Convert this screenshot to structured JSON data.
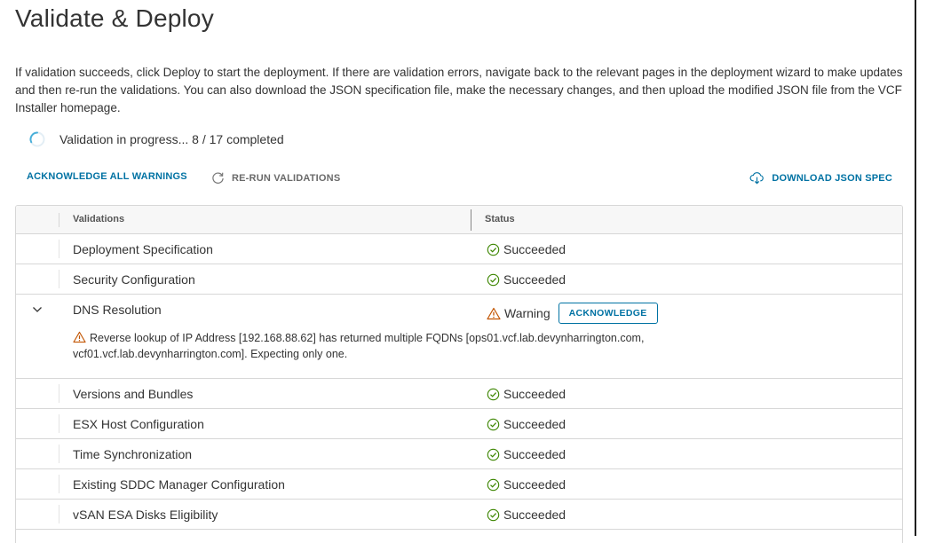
{
  "page": {
    "title": "Validate & Deploy",
    "description": "If validation succeeds, click Deploy to start the deployment. If there are validation errors, navigate back to the relevant pages in the deployment wizard to make updates and then re-run the validations. You can also download the JSON specification file, make the necessary changes, and then upload the modified JSON file from the VCF Installer homepage.",
    "progress_text": "Validation in progress... 8 / 17 completed"
  },
  "toolbar": {
    "acknowledge_all": "ACKNOWLEDGE ALL WARNINGS",
    "rerun": "RE-RUN VALIDATIONS",
    "download": "DOWNLOAD JSON SPEC"
  },
  "grid": {
    "col_validations": "Validations",
    "col_status": "Status",
    "rows": [
      {
        "name": "Deployment Specification",
        "status": "Succeeded"
      },
      {
        "name": "Security Configuration",
        "status": "Succeeded"
      },
      {
        "name": "DNS Resolution",
        "status": "Warning",
        "action": "ACKNOWLEDGE",
        "detail": "Reverse lookup of IP Address [192.168.88.62] has returned multiple FQDNs [ops01.vcf.lab.devynharrington.com, vcf01.vcf.lab.devynharrington.com]. Expecting only one."
      },
      {
        "name": "Versions and Bundles",
        "status": "Succeeded"
      },
      {
        "name": "ESX Host Configuration",
        "status": "Succeeded"
      },
      {
        "name": "Time Synchronization",
        "status": "Succeeded"
      },
      {
        "name": "Existing SDDC Manager Configuration",
        "status": "Succeeded"
      },
      {
        "name": "vSAN ESA Disks Eligibility",
        "status": "Succeeded"
      }
    ]
  },
  "colors": {
    "accent": "#0072a3",
    "success": "#3c8500",
    "warning": "#c25400"
  }
}
